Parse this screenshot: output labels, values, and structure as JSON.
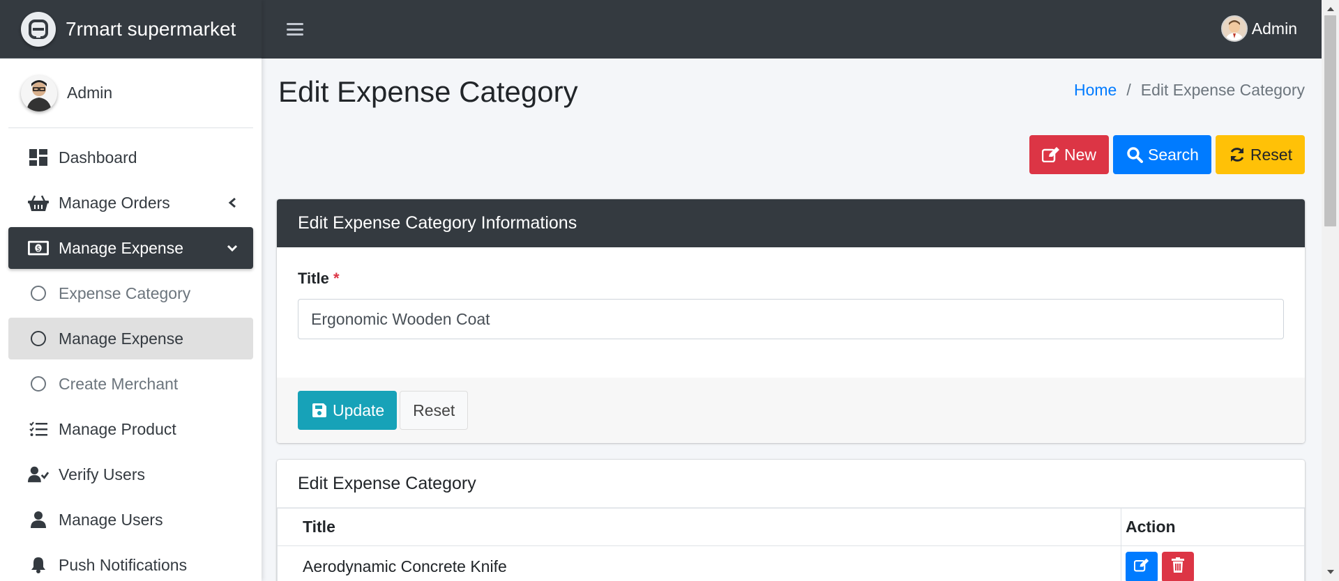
{
  "brand": {
    "name": "7rmart supermarket"
  },
  "sidebar": {
    "user_name": "Admin",
    "items": [
      {
        "label": "Dashboard",
        "icon": "dashboard-icon"
      },
      {
        "label": "Manage Orders",
        "icon": "basket-icon"
      },
      {
        "label": "Manage Expense",
        "icon": "money-bill-icon"
      },
      {
        "label": "Expense Category",
        "icon": "circle-icon"
      },
      {
        "label": "Manage Expense",
        "icon": "circle-icon"
      },
      {
        "label": "Create Merchant",
        "icon": "circle-icon"
      },
      {
        "label": "Manage Product",
        "icon": "list-check-icon"
      },
      {
        "label": "Verify Users",
        "icon": "user-check-icon"
      },
      {
        "label": "Manage Users",
        "icon": "user-icon"
      },
      {
        "label": "Push Notifications",
        "icon": "bell-icon"
      }
    ]
  },
  "topbar": {
    "user_name": "Admin"
  },
  "page": {
    "title": "Edit Expense Category",
    "breadcrumb": {
      "home": "Home",
      "current": "Edit Expense Category"
    }
  },
  "actions": {
    "new_label": "New",
    "search_label": "Search",
    "reset_label": "Reset"
  },
  "form_card": {
    "header": "Edit Expense Category Informations",
    "title_label": "Title",
    "required_mark": "*",
    "title_value": "Ergonomic Wooden Coat",
    "update_label": "Update",
    "reset_label": "Reset"
  },
  "list_card": {
    "header": "Edit Expense Category",
    "columns": [
      "Title",
      "Action"
    ],
    "rows": [
      {
        "title": "Aerodynamic Concrete Knife"
      }
    ]
  },
  "colors": {
    "dark": "#343a40",
    "primary": "#007bff",
    "danger": "#dc3545",
    "warning": "#ffc107",
    "info": "#17a2b8"
  }
}
